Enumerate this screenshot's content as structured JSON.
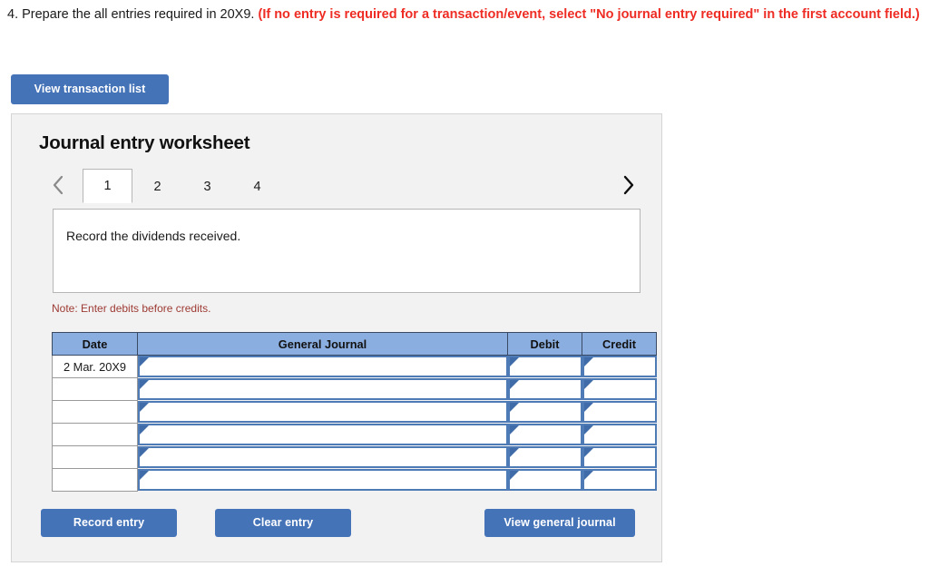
{
  "question": {
    "number_and_text": "4. Prepare the all entries required in 20X9. ",
    "requirement_note": "(If no entry is required for a transaction/event, select \"No journal entry required\" in the first account field.)"
  },
  "toolbar": {
    "view_transaction_list_label": "View transaction list"
  },
  "worksheet": {
    "title": "Journal entry worksheet",
    "prev_icon": "chevron-left-icon",
    "next_icon": "chevron-right-icon",
    "tabs": [
      {
        "label": "1",
        "active": true
      },
      {
        "label": "2",
        "active": false
      },
      {
        "label": "3",
        "active": false
      },
      {
        "label": "4",
        "active": false
      }
    ],
    "description": "Record the dividends received.",
    "note": "Note: Enter debits before credits."
  },
  "table": {
    "columns": [
      "Date",
      "General Journal",
      "Debit",
      "Credit"
    ],
    "rows": [
      {
        "date": "2 Mar. 20X9",
        "general_journal": "",
        "debit": "",
        "credit": ""
      },
      {
        "date": "",
        "general_journal": "",
        "debit": "",
        "credit": ""
      },
      {
        "date": "",
        "general_journal": "",
        "debit": "",
        "credit": ""
      },
      {
        "date": "",
        "general_journal": "",
        "debit": "",
        "credit": ""
      },
      {
        "date": "",
        "general_journal": "",
        "debit": "",
        "credit": ""
      },
      {
        "date": "",
        "general_journal": "",
        "debit": "",
        "credit": ""
      }
    ]
  },
  "footer": {
    "record_entry_label": "Record entry",
    "clear_entry_label": "Clear entry",
    "view_general_journal_label": "View general journal"
  },
  "colors": {
    "button_blue": "#4573b8",
    "table_header_blue": "#8aaee0",
    "cell_border_blue": "#4e7ab5",
    "panel_gray": "#f2f2f2",
    "alert_red": "#ee2c24",
    "note_red": "#9e3a33"
  }
}
